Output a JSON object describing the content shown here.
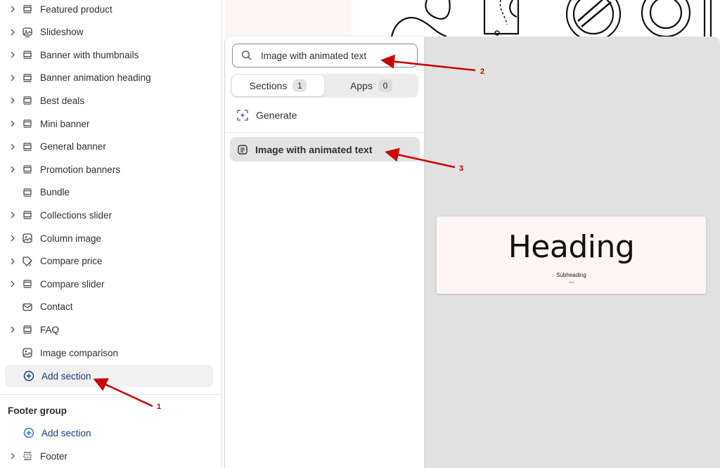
{
  "sidebar": {
    "items": [
      {
        "label": "Featured product",
        "chevron": true,
        "icon": "section-icon"
      },
      {
        "label": "Slideshow",
        "chevron": true,
        "icon": "slideshow-icon"
      },
      {
        "label": "Banner with thumbnails",
        "chevron": true,
        "icon": "section-icon"
      },
      {
        "label": "Banner animation heading",
        "chevron": true,
        "icon": "section-icon"
      },
      {
        "label": "Best deals",
        "chevron": true,
        "icon": "section-icon"
      },
      {
        "label": "Mini banner",
        "chevron": true,
        "icon": "section-icon"
      },
      {
        "label": "General banner",
        "chevron": true,
        "icon": "section-icon"
      },
      {
        "label": "Promotion banners",
        "chevron": true,
        "icon": "section-icon"
      },
      {
        "label": "Bundle",
        "chevron": false,
        "icon": "section-icon"
      },
      {
        "label": "Collections slider",
        "chevron": true,
        "icon": "section-icon"
      },
      {
        "label": "Column image",
        "chevron": true,
        "icon": "image-icon"
      },
      {
        "label": "Compare price",
        "chevron": true,
        "icon": "price-tag-icon"
      },
      {
        "label": "Compare slider",
        "chevron": true,
        "icon": "section-icon"
      },
      {
        "label": "Contact",
        "chevron": false,
        "icon": "envelope-icon"
      },
      {
        "label": "FAQ",
        "chevron": true,
        "icon": "section-icon"
      },
      {
        "label": "Image comparison",
        "chevron": false,
        "icon": "image-icon"
      }
    ],
    "add_section_label": "Add section",
    "footer_group_title": "Footer group",
    "footer_add_section_label": "Add section",
    "footer_item_label": "Footer"
  },
  "popover": {
    "search_value": "Image with animated text",
    "tabs": [
      {
        "label": "Sections",
        "count": "1"
      },
      {
        "label": "Apps",
        "count": "0"
      }
    ],
    "generate_label": "Generate",
    "result_label": "Image with animated text"
  },
  "preview": {
    "heading": "Heading",
    "subheading": "Subheading",
    "text": "Text"
  },
  "annotations": {
    "labels": [
      "1",
      "2",
      "3"
    ],
    "color": "#cc0000"
  },
  "colors": {
    "accent_blue": "#1a3a7a",
    "generate_purple": "#7b4fd6"
  }
}
